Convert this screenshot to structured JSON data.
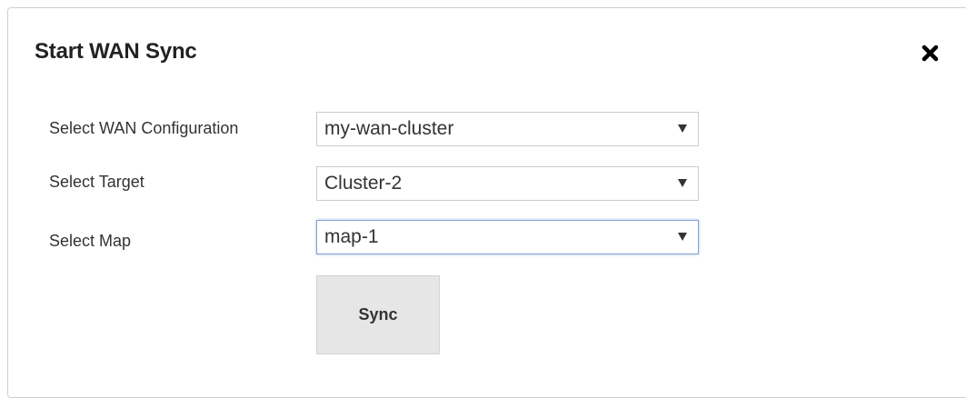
{
  "dialog": {
    "title": "Start WAN Sync",
    "close_icon": "close-icon"
  },
  "form": {
    "wan_config": {
      "label": "Select WAN Configuration",
      "value": "my-wan-cluster"
    },
    "target": {
      "label": "Select Target",
      "value": "Cluster-2"
    },
    "map": {
      "label": "Select Map",
      "value": "map-1"
    },
    "sync_label": "Sync"
  },
  "colors": {
    "focus_border": "#7ea3cf",
    "button_bg": "#e6e6e6"
  }
}
